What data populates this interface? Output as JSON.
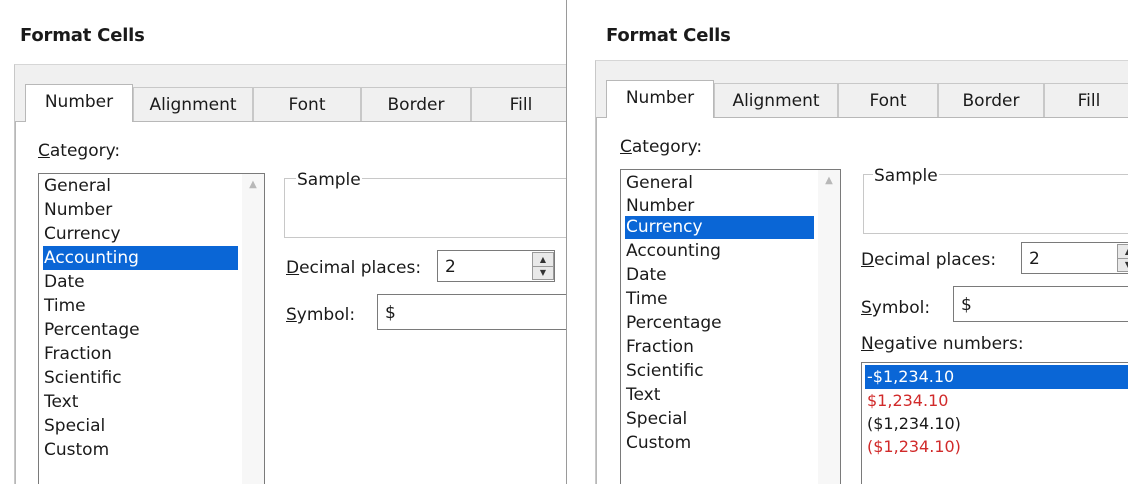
{
  "left": {
    "title": "Format Cells",
    "tabs": [
      "Number",
      "Alignment",
      "Font",
      "Border",
      "Fill"
    ],
    "category_label": "Category:",
    "categories": [
      "General",
      "Number",
      "Currency",
      "Accounting",
      "Date",
      "Time",
      "Percentage",
      "Fraction",
      "Scientific",
      "Text",
      "Special",
      "Custom"
    ],
    "selected_category": "Accounting",
    "sample_label": "Sample",
    "decimal_label": "Decimal places:",
    "decimal_value": "2",
    "symbol_label": "Symbol:",
    "symbol_value": "$"
  },
  "right": {
    "title": "Format Cells",
    "tabs": [
      "Number",
      "Alignment",
      "Font",
      "Border",
      "Fill"
    ],
    "category_label": "Category:",
    "categories": [
      "General",
      "Number",
      "Currency",
      "Accounting",
      "Date",
      "Time",
      "Percentage",
      "Fraction",
      "Scientific",
      "Text",
      "Special",
      "Custom"
    ],
    "selected_category": "Currency",
    "sample_label": "Sample",
    "decimal_label": "Decimal places:",
    "decimal_value": "2",
    "symbol_label": "Symbol:",
    "symbol_value": "$",
    "negative_label": "Negative numbers:",
    "negative_options": [
      {
        "text": "-$1,234.10",
        "color": "selected"
      },
      {
        "text": "$1,234.10",
        "color": "red"
      },
      {
        "text": "($1,234.10)",
        "color": "black"
      },
      {
        "text": "($1,234.10)",
        "color": "red"
      }
    ]
  },
  "colors": {
    "selection": "#0a66d6",
    "negative_red": "#d12a2a",
    "dialog_background": "#f0f0f0"
  }
}
